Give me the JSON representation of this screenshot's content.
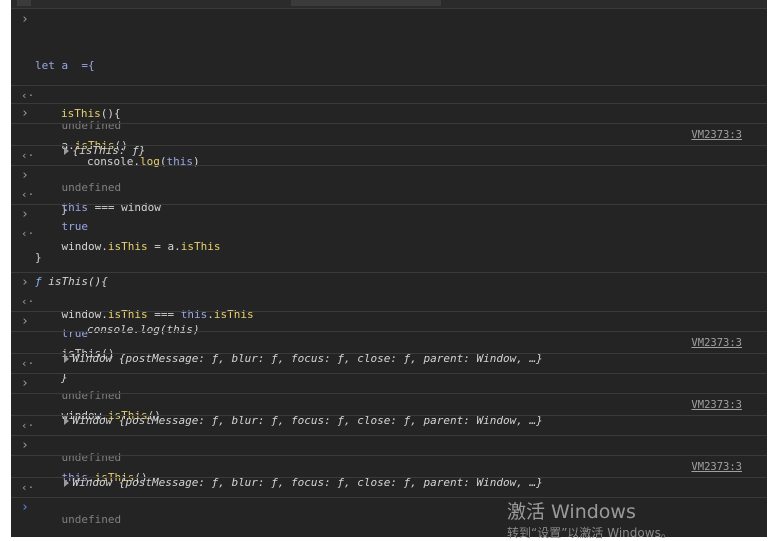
{
  "entries": {
    "e1": {
      "l1": "let a  ={",
      "l2_fn": "isThis",
      "l2_rest": "(){",
      "l3_obj": "console.",
      "l3_fn": "log",
      "l3_p1": "(",
      "l3_this": "this",
      "l3_p2": ")",
      "l4": "}",
      "l5": "}"
    },
    "e2": {
      "text": "undefined"
    },
    "e3": {
      "obj": "a.",
      "fn": "isThis",
      "rest": "()"
    },
    "e4": {
      "text": "{isThis: ƒ}",
      "source": "VM2373:3"
    },
    "e5": {
      "text": "undefined"
    },
    "e6": {
      "kw": "this",
      "op": " === ",
      "obj": "window"
    },
    "e7": {
      "text": "true"
    },
    "e8": {
      "obj": "window.",
      "fn": "isThis",
      "op": " = a.",
      "fn2": "isThis"
    },
    "e9": {
      "l1_f": "ƒ",
      "l1_rest": " isThis(){",
      "l2": "console.log(this)",
      "l3": "}"
    },
    "e10": {
      "obj": "window.",
      "fn": "isThis",
      "op": " === ",
      "kw": "this",
      "dot": ".",
      "fn2": "isThis"
    },
    "e11": {
      "text": "true"
    },
    "e12": {
      "text": "isThis()"
    },
    "e13": {
      "text": "Window {postMessage: ƒ, blur: ƒ, focus: ƒ, close: ƒ, parent: Window, …}",
      "source": "VM2373:3"
    },
    "e14": {
      "text": "undefined"
    },
    "e15": {
      "obj": "window.",
      "fn": "isThis",
      "rest": "()"
    },
    "e16": {
      "text": "Window {postMessage: ƒ, blur: ƒ, focus: ƒ, close: ƒ, parent: Window, …}",
      "source": "VM2373:3"
    },
    "e17": {
      "text": "undefined"
    },
    "e18": {
      "kw": "this",
      "dot": ".",
      "fn": "isThis",
      "rest": "()"
    },
    "e19": {
      "text": "Window {postMessage: ƒ, blur: ƒ, focus: ƒ, close: ƒ, parent: Window, …}",
      "source": "VM2373:3"
    },
    "e20": {
      "text": "undefined"
    }
  },
  "watermark": {
    "line1": "激活 Windows",
    "line2": "转到“设置”以激活 Windows。"
  },
  "colors": {
    "background": "#242424",
    "keyword": "#9aa7e8",
    "method": "#e8d06e",
    "prompt": "#4d90fe"
  },
  "icons": {
    "input_prompt": "chevron-right-icon",
    "output_marker": "return-arrow-icon",
    "expand": "triangle-right-icon"
  }
}
